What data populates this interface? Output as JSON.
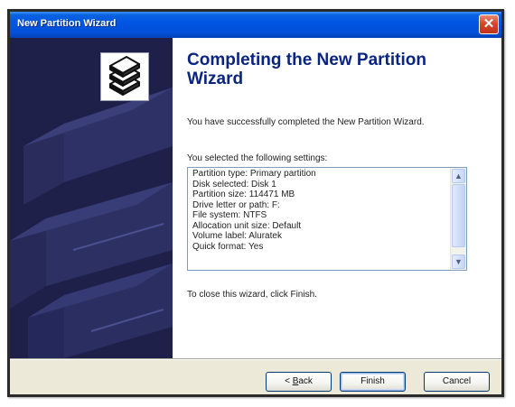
{
  "window": {
    "title": "New Partition Wizard",
    "close_label": "✕"
  },
  "main": {
    "heading": "Completing the New Partition Wizard",
    "success_text": "You have successfully completed the New Partition Wizard.",
    "settings_label": "You selected the following settings:",
    "settings_lines": [
      "Partition type: Primary partition",
      "Disk selected: Disk 1",
      "Partition size: 114471 MB",
      "Drive letter or path: F:",
      "File system: NTFS",
      "Allocation unit size: Default",
      "Volume label: Aluratek",
      "Quick format: Yes"
    ],
    "close_text": "To close this wizard, click Finish."
  },
  "footer": {
    "back_underline": "B",
    "back_rest": "ack",
    "back_prefix": "< ",
    "finish_label": "Finish",
    "cancel_label": "Cancel"
  },
  "icons": {
    "wizard": "stacked-disks-icon",
    "scroll_up": "chevron-up-icon",
    "scroll_down": "chevron-down-icon"
  },
  "colors": {
    "titlebar": "#0054e3",
    "close_button": "#d4472a",
    "left_panel": "#1f2049",
    "heading": "#0a2580"
  }
}
